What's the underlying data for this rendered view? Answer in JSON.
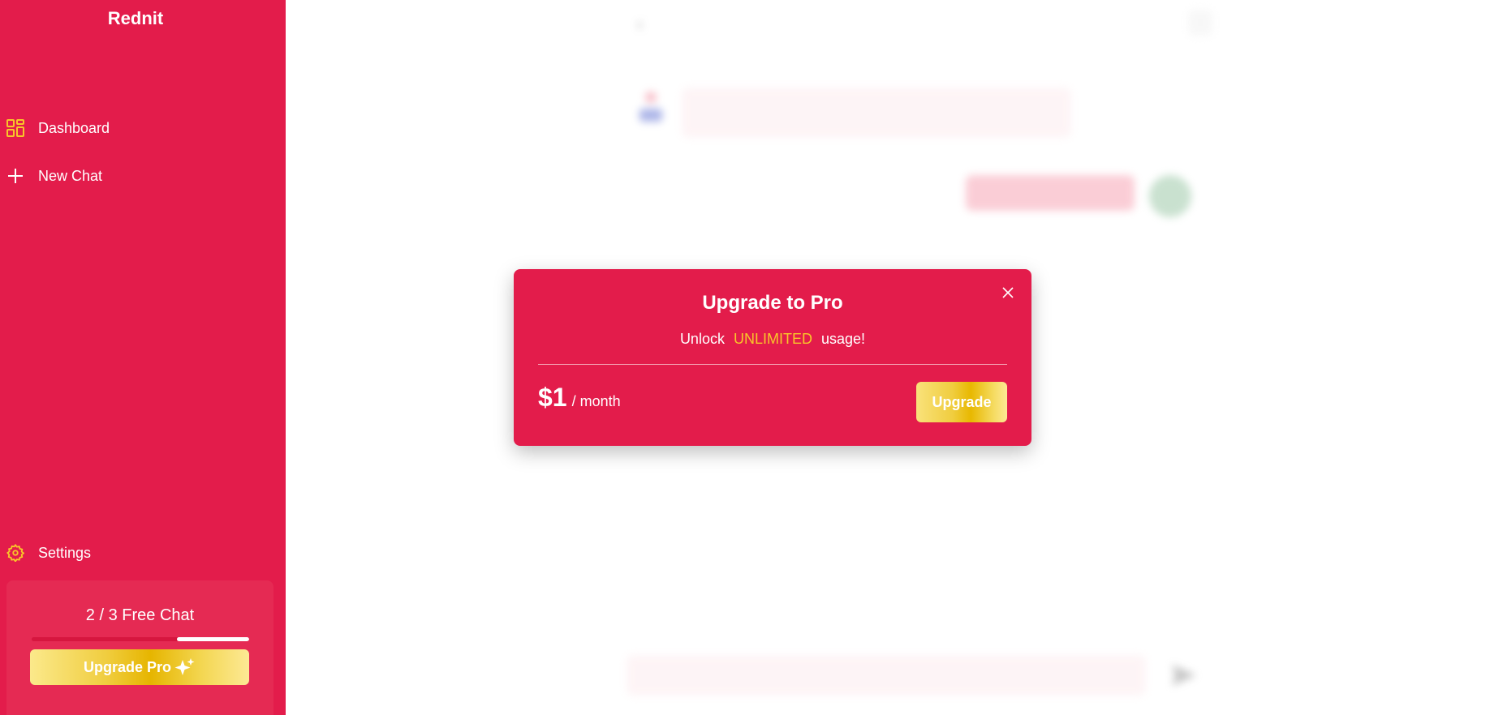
{
  "sidebar": {
    "brand": "Rednit",
    "items": [
      {
        "label": "Dashboard",
        "icon": "dashboard-icon"
      },
      {
        "label": "New Chat",
        "icon": "plus-icon"
      }
    ],
    "settings_label": "Settings",
    "free_chat": {
      "text": "2 / 3 Free Chat",
      "used": 2,
      "total": 3,
      "upgrade_label": "Upgrade Pro"
    }
  },
  "modal": {
    "title": "Upgrade to Pro",
    "subtitle_prefix": "Unlock",
    "subtitle_highlight": "UNLIMITED",
    "subtitle_suffix": "usage!",
    "price": "$1",
    "period": "/ month",
    "upgrade_label": "Upgrade"
  },
  "colors": {
    "brand_red": "#e31c4b",
    "highlight_yellow": "#f8c629",
    "gold": "#e8b800"
  }
}
